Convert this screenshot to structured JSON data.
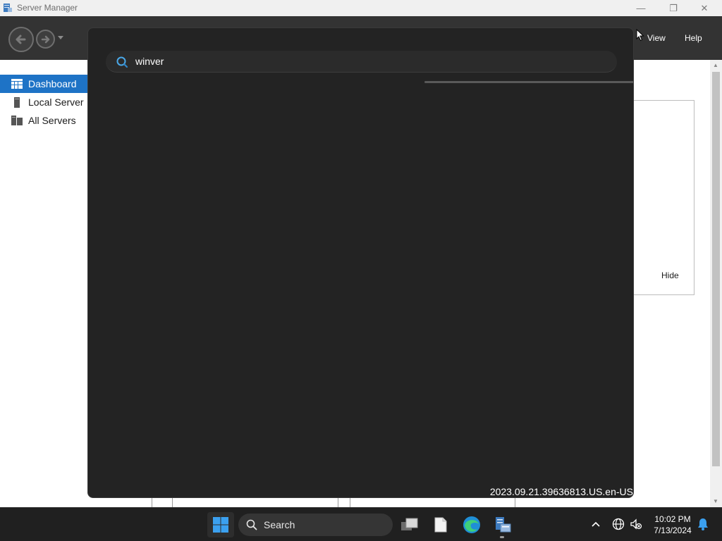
{
  "window": {
    "title": "Server Manager",
    "controls": {
      "minimize": "—",
      "maximize": "❐",
      "close": "✕"
    }
  },
  "navbar": {
    "menu": [
      {
        "label": "View"
      },
      {
        "label": "Help"
      }
    ]
  },
  "sidebar": {
    "items": [
      {
        "label": "Dashboard",
        "icon": "dashboard-icon",
        "selected": true
      },
      {
        "label": "Local Server",
        "icon": "local-server-icon",
        "selected": false
      },
      {
        "label": "All Servers",
        "icon": "all-servers-icon",
        "selected": false
      }
    ]
  },
  "main": {
    "hide_label": "Hide"
  },
  "search_panel": {
    "query": "winver",
    "watermark": "2023.09.21.39636813.US.en-US"
  },
  "taskbar": {
    "search_label": "Search",
    "apps": [
      {
        "name": "task-view-icon"
      },
      {
        "name": "file-icon"
      },
      {
        "name": "edge-icon"
      },
      {
        "name": "server-manager-icon"
      }
    ],
    "clock": {
      "time": "10:02 PM",
      "date": "7/13/2024"
    }
  },
  "colors": {
    "accent": "#1e73c6",
    "navbar": "#333333",
    "panel": "#232323",
    "taskbar": "#202020"
  }
}
